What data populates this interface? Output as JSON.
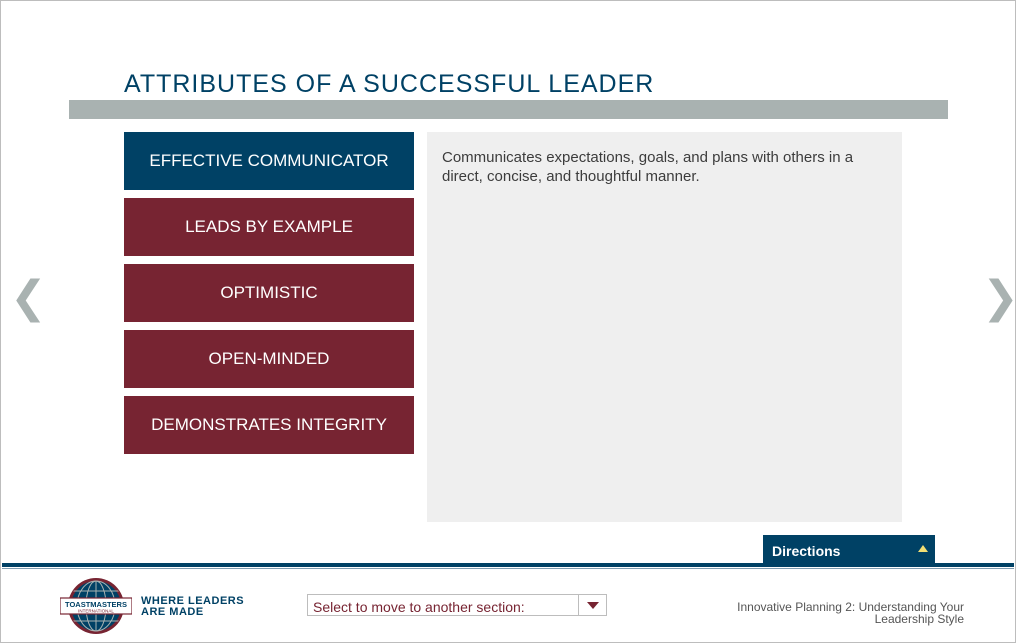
{
  "slide": {
    "title": "ATTRIBUTES OF A SUCCESSFUL LEADER"
  },
  "tabs": [
    {
      "label": "EFFECTIVE COMMUNICATOR",
      "active": true
    },
    {
      "label": "LEADS BY EXAMPLE",
      "active": false
    },
    {
      "label": "OPTIMISTIC",
      "active": false
    },
    {
      "label": "OPEN-MINDED",
      "active": false
    },
    {
      "label": "DEMONSTRATES INTEGRITY",
      "active": false
    }
  ],
  "content": {
    "text": "Communicates expectations, goals, and plans with others in a direct, concise, and thoughtful manner."
  },
  "nav": {
    "prev_icon": "chevron-left-icon",
    "prev_glyph": "❮",
    "next_icon": "chevron-right-icon",
    "next_glyph": "❯"
  },
  "directions": {
    "label": "Directions",
    "icon": "caret-up-icon"
  },
  "footer": {
    "logo_icon": "toastmasters-globe-logo",
    "logo_name": "TOASTMASTERS",
    "logo_sub": "INTERNATIONAL",
    "tagline_line1": "WHERE LEADERS",
    "tagline_line2": "ARE MADE",
    "section_select_label": "Select to move to another section:",
    "course_title": "Innovative Planning 2: Understanding Your Leadership Style"
  },
  "colors": {
    "navy": "#004165",
    "maroon": "#772432",
    "gray": "#a9b2b1",
    "panel": "#efefef",
    "gold": "#f2df74"
  }
}
